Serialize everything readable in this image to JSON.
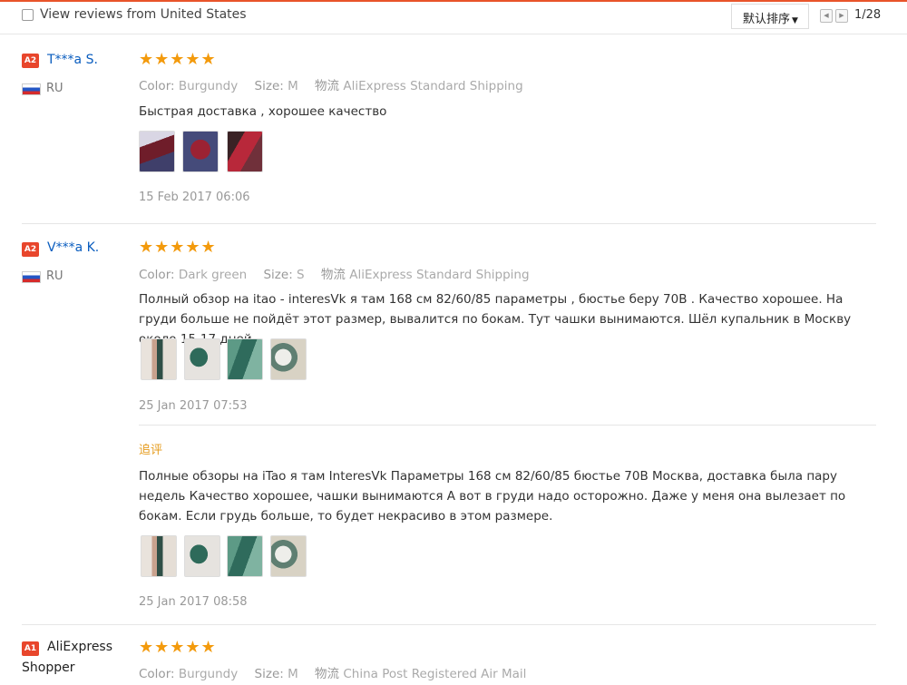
{
  "filter": {
    "label": "View reviews from United States"
  },
  "sort": {
    "label": "默认排序"
  },
  "pager": {
    "text": "1/28"
  },
  "reviews": [
    {
      "level": "A2",
      "name": "T***a S.",
      "country": "RU",
      "stars": "★★★★★",
      "color_key": "Color:",
      "color": "Burgundy",
      "size_key": "Size:",
      "size": "M",
      "ship_key": "物流",
      "shipping": "AliExpress Standard Shipping",
      "text": "Быстрая доставка , хорошее качество",
      "date": "15 Feb 2017 06:06"
    },
    {
      "level": "A2",
      "name": "V***a K.",
      "country": "RU",
      "stars": "★★★★★",
      "color_key": "Color:",
      "color": "Dark green",
      "size_key": "Size:",
      "size": "S",
      "ship_key": "物流",
      "shipping": "AliExpress Standard Shipping",
      "text": "Полный обзор на itao - interesVk я там 168 см 82/60/85 параметры , бюстье беру 70B . Качество хорошее. На груди больше не пойдёт этот размер, вывалится по бокам. Тут чашки вынимаются. Шёл купальник в Москву около 15-17 дней.",
      "date": "25 Jan 2017 07:53",
      "followup_label": "追评",
      "followup_text": "Полные обзоры на iTao я там InteresVk Параметры 168 см 82/60/85 бюстье 70B Москва, доставка была пару недель Качество хорошее, чашки вынимаются А вот в груди надо осторожно. Даже у меня она вылезает по бокам. Если грудь больше, то будет некрасиво в этом размере.",
      "followup_date": "25 Jan 2017 08:58"
    },
    {
      "level": "A1",
      "name_line1": "AliExpress",
      "name_line2": "Shopper",
      "stars": "★★★★★",
      "color_key": "Color:",
      "color": "Burgundy",
      "size_key": "Size:",
      "size": "M",
      "ship_key": "物流",
      "shipping": "China Post Registered Air Mail"
    }
  ]
}
